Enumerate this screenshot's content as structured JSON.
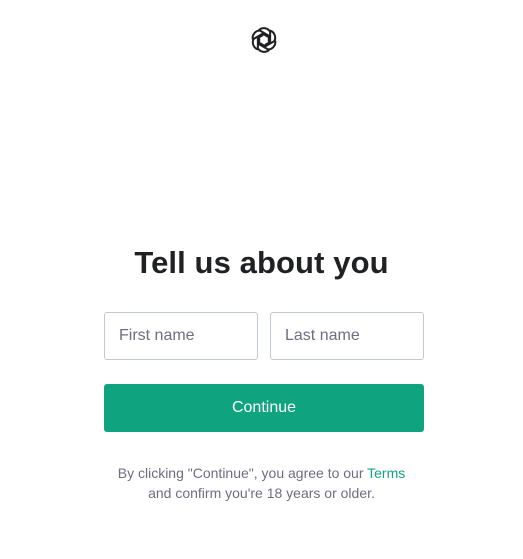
{
  "logo": {
    "icon": "openai-logo-icon",
    "color": "#202123"
  },
  "title": "Tell us about you",
  "form": {
    "first_name_placeholder": "First name",
    "last_name_placeholder": "Last name",
    "first_name_value": "",
    "last_name_value": "",
    "continue_label": "Continue"
  },
  "terms": {
    "line1_prefix": "By clicking \"Continue\", you agree to our ",
    "link_label": "Terms",
    "line2": "and confirm you're 18 years or older."
  },
  "colors": {
    "accent": "#10a37f",
    "text": "#202123",
    "muted": "#6e6e80",
    "border": "#c2c8d0"
  }
}
